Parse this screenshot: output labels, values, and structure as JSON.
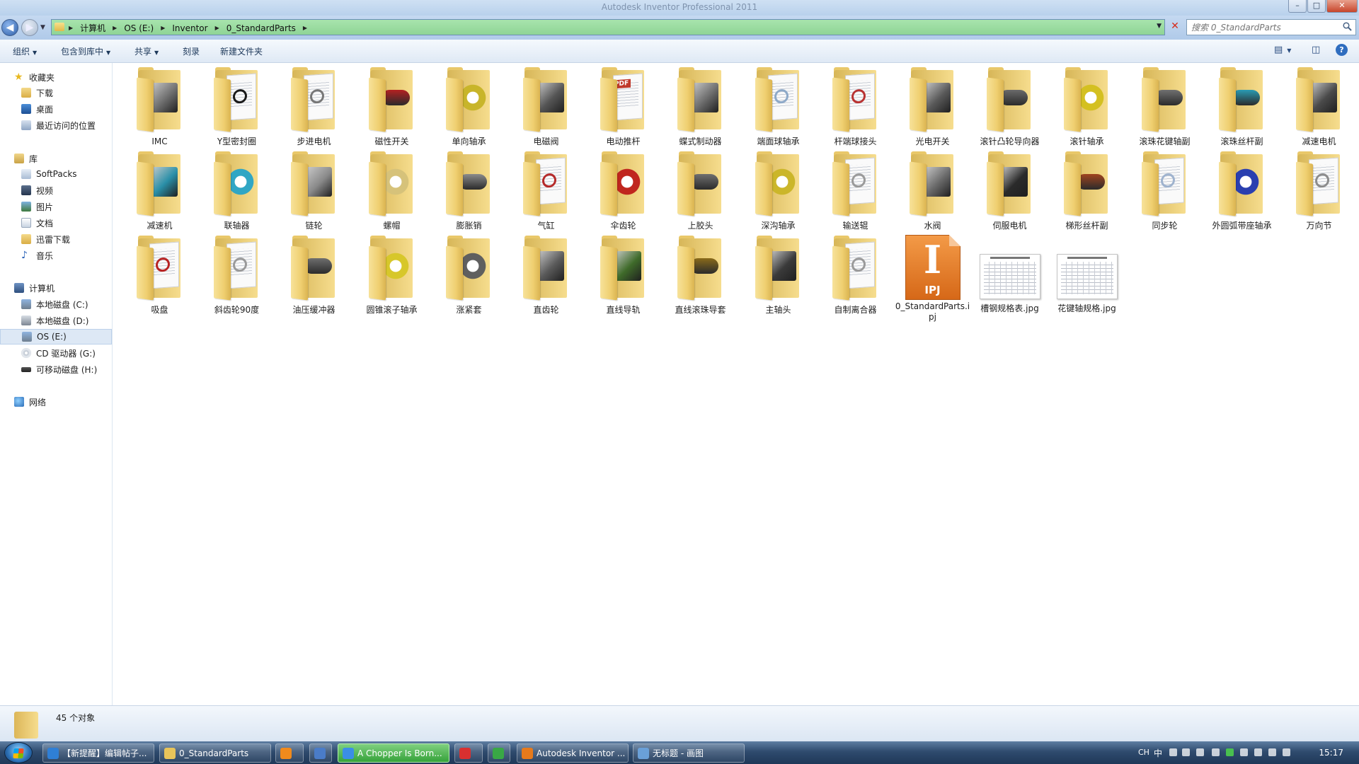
{
  "window": {
    "title": "Autodesk Inventor Professional 2011"
  },
  "address": {
    "crumbs": [
      "计算机",
      "OS (E:)",
      "Inventor",
      "0_StandardParts"
    ]
  },
  "search": {
    "placeholder": "搜索 0_StandardParts"
  },
  "toolbar": {
    "organize": "组织",
    "include_library": "包含到库中",
    "share": "共享",
    "burn": "刻录",
    "new_folder": "新建文件夹"
  },
  "nav": {
    "favorites": {
      "label": "收藏夹",
      "items": [
        "下载",
        "桌面",
        "最近访问的位置"
      ]
    },
    "libraries": {
      "label": "库",
      "items": [
        "SoftPacks",
        "视频",
        "图片",
        "文档",
        "迅雷下载",
        "音乐"
      ]
    },
    "computer": {
      "label": "计算机",
      "items": [
        "本地磁盘 (C:)",
        "本地磁盘 (D:)",
        "OS (E:)",
        "CD 驱动器 (G:)",
        "可移动磁盘 (H:)"
      ]
    },
    "network": {
      "label": "网络"
    }
  },
  "files": [
    {
      "name": "IMC",
      "type": "folder",
      "accent": "#6f6f6f",
      "shape": "block"
    },
    {
      "name": "Y型密封圈",
      "type": "folder",
      "accent": "#1a1a1a",
      "shape": "doc"
    },
    {
      "name": "步进电机",
      "type": "folder",
      "accent": "#777777",
      "shape": "doc"
    },
    {
      "name": "磁性开关",
      "type": "folder",
      "accent": "#b32121",
      "shape": "cyl"
    },
    {
      "name": "单向轴承",
      "type": "folder",
      "accent": "#c8b52a",
      "shape": "ring"
    },
    {
      "name": "电磁阀",
      "type": "folder",
      "accent": "#555555",
      "shape": "block"
    },
    {
      "name": "电动推杆",
      "type": "folder",
      "accent": "#c0392b",
      "shape": "pdf"
    },
    {
      "name": "蝶式制动器",
      "type": "folder",
      "accent": "#6d6d6d",
      "shape": "block"
    },
    {
      "name": "端面球轴承",
      "type": "folder",
      "accent": "#8ea9c8",
      "shape": "doc"
    },
    {
      "name": "杆端球接头",
      "type": "folder",
      "accent": "#b83232",
      "shape": "doc"
    },
    {
      "name": "光电开关",
      "type": "folder",
      "accent": "#5a5a5a",
      "shape": "block"
    },
    {
      "name": "滚针凸轮导向器",
      "type": "folder",
      "accent": "#6a6a6a",
      "shape": "cyl"
    },
    {
      "name": "滚针轴承",
      "type": "folder",
      "accent": "#d4c021",
      "shape": "ring"
    },
    {
      "name": "滚珠花键轴副",
      "type": "folder",
      "accent": "#707070",
      "shape": "cyl"
    },
    {
      "name": "滚珠丝杆副",
      "type": "folder",
      "accent": "#2a9bb3",
      "shape": "cyl"
    },
    {
      "name": "减速电机",
      "type": "folder",
      "accent": "#4a4a4a",
      "shape": "block"
    },
    {
      "name": "减速机",
      "type": "folder",
      "accent": "#2a8fa8",
      "shape": "block"
    },
    {
      "name": "联轴器",
      "type": "folder",
      "accent": "#30a6c4",
      "shape": "ring"
    },
    {
      "name": "链轮",
      "type": "folder",
      "accent": "#8a8a8a",
      "shape": "block"
    },
    {
      "name": "螺帽",
      "type": "folder",
      "accent": "#d6c27a",
      "shape": "ring"
    },
    {
      "name": "膨胀销",
      "type": "folder",
      "accent": "#8b8b8b",
      "shape": "cyl"
    },
    {
      "name": "气缸",
      "type": "folder",
      "accent": "#b52a2a",
      "shape": "doc"
    },
    {
      "name": "伞齿轮",
      "type": "folder",
      "accent": "#c0261e",
      "shape": "ring"
    },
    {
      "name": "上胶头",
      "type": "folder",
      "accent": "#6f6f6f",
      "shape": "cyl"
    },
    {
      "name": "深沟轴承",
      "type": "folder",
      "accent": "#cbb62a",
      "shape": "ring"
    },
    {
      "name": "输送辊",
      "type": "folder",
      "accent": "#9a9a9a",
      "shape": "doc"
    },
    {
      "name": "水阀",
      "type": "folder",
      "accent": "#6a6a6a",
      "shape": "block"
    },
    {
      "name": "伺服电机",
      "type": "folder",
      "accent": "#2b2b2b",
      "shape": "block"
    },
    {
      "name": "梯形丝杆副",
      "type": "folder",
      "accent": "#a0441f",
      "shape": "cyl"
    },
    {
      "name": "同步轮",
      "type": "folder",
      "accent": "#9fb3ce",
      "shape": "doc"
    },
    {
      "name": "外圆弧带座轴承",
      "type": "folder",
      "accent": "#2a3fb0",
      "shape": "ring"
    },
    {
      "name": "万向节",
      "type": "folder",
      "accent": "#8c8c8c",
      "shape": "doc"
    },
    {
      "name": "吸盘",
      "type": "folder",
      "accent": "#b72323",
      "shape": "doc"
    },
    {
      "name": "斜齿轮90度",
      "type": "folder",
      "accent": "#9a9a9a",
      "shape": "doc"
    },
    {
      "name": "油压缓冲器",
      "type": "folder",
      "accent": "#6e6e6e",
      "shape": "cyl"
    },
    {
      "name": "圆锥滚子轴承",
      "type": "folder",
      "accent": "#d7c72a",
      "shape": "ring"
    },
    {
      "name": "涨紧套",
      "type": "folder",
      "accent": "#5f5f5f",
      "shape": "ring"
    },
    {
      "name": "直齿轮",
      "type": "folder",
      "accent": "#5a5a5a",
      "shape": "block"
    },
    {
      "name": "直线导轨",
      "type": "folder",
      "accent": "#3f6b2a",
      "shape": "block"
    },
    {
      "name": "直线滚珠导套",
      "type": "folder",
      "accent": "#8a6a1a",
      "shape": "cyl"
    },
    {
      "name": "主轴头",
      "type": "folder",
      "accent": "#3a3a3a",
      "shape": "block"
    },
    {
      "name": "自制离合器",
      "type": "folder",
      "accent": "#9a9a9a",
      "shape": "doc"
    },
    {
      "name": "0_StandardParts.ipj",
      "type": "ipj",
      "badge": "IPJ",
      "letter": "I"
    },
    {
      "name": "槽钢规格表.jpg",
      "type": "image"
    },
    {
      "name": "花键轴规格.jpg",
      "type": "image"
    }
  ],
  "status": {
    "count": "45 个对象"
  },
  "taskbar": {
    "tasks": [
      {
        "label": "【新提醒】编辑帖子...",
        "color": "#2f7fd6"
      },
      {
        "label": "0_StandardParts",
        "color": "#e8c45a"
      },
      {
        "label": "",
        "color": "#f08a1c"
      },
      {
        "label": "",
        "color": "#4a7cc8"
      },
      {
        "label": "A Chopper Is Born...",
        "color": "#3b8ee6"
      },
      {
        "label": "",
        "color": "#d93030"
      },
      {
        "label": "",
        "color": "#39a845"
      },
      {
        "label": "Autodesk Inventor ...",
        "color": "#e67a1c"
      },
      {
        "label": "无标题 - 画图",
        "color": "#6aa0d8"
      }
    ],
    "tray": {
      "lang": "CH",
      "ime": "中",
      "time": "15:17"
    }
  }
}
